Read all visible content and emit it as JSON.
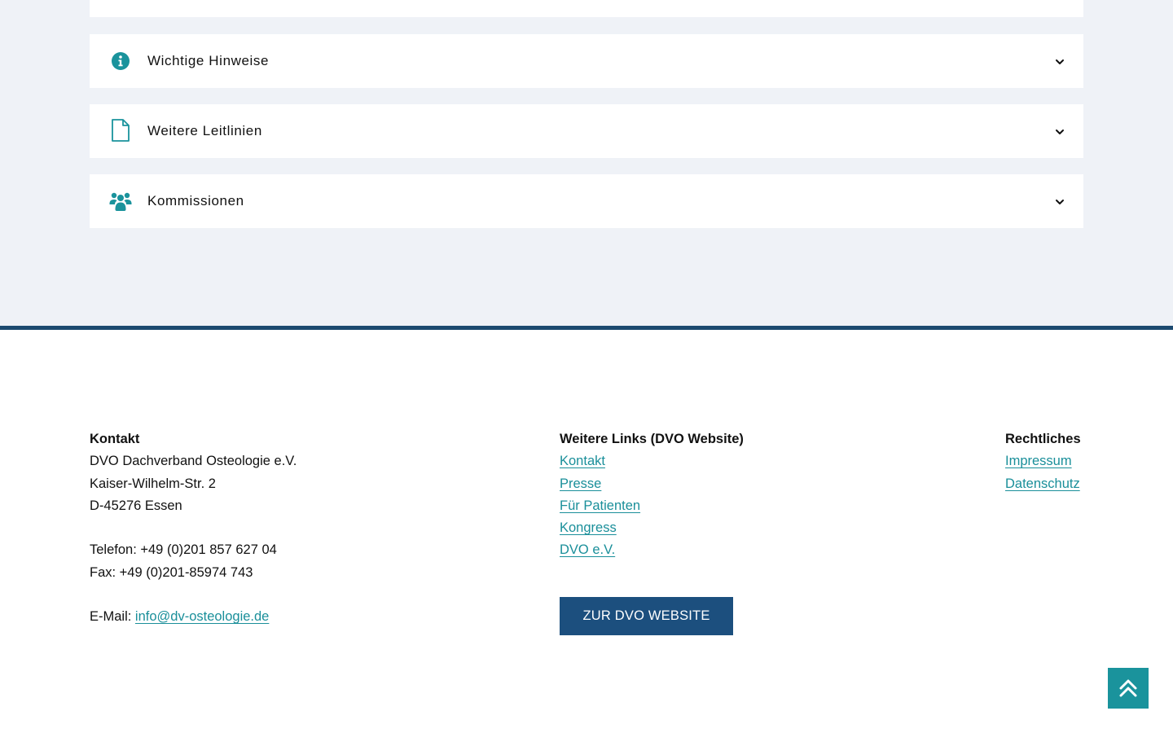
{
  "accordion": {
    "items": [
      {
        "label": "Wichtige Hinweise",
        "icon": "info-circle-icon"
      },
      {
        "label": "Weitere Leitlinien",
        "icon": "document-icon"
      },
      {
        "label": "Kommissionen",
        "icon": "users-icon"
      }
    ]
  },
  "footer": {
    "kontakt": {
      "heading": "Kontakt",
      "org": "DVO Dachverband Osteologie e.V.",
      "street": "Kaiser-Wilhelm-Str. 2",
      "city": "D-45276 Essen",
      "phone": "Telefon: +49 (0)201 857 627 04",
      "fax": "Fax: +49 (0)201-85974 743",
      "email_label": "E-Mail: ",
      "email": "info@dv-osteologie.de"
    },
    "links": {
      "heading": "Weitere Links (DVO Website)",
      "items": [
        "Kontakt",
        "Presse",
        "Für Patienten",
        "Kongress",
        "DVO e.V."
      ],
      "button_label": "ZUR DVO WEBSITE"
    },
    "legal": {
      "heading": "Rechtliches",
      "items": [
        "Impressum",
        "Datenschutz"
      ]
    }
  },
  "colors": {
    "accent_teal": "#1a939c",
    "footer_bar": "#1c4a70",
    "button_bg": "#1c4f7e",
    "page_bg": "#eff2f7"
  },
  "scroll_top": {
    "icon": "double-chevron-up-icon"
  }
}
